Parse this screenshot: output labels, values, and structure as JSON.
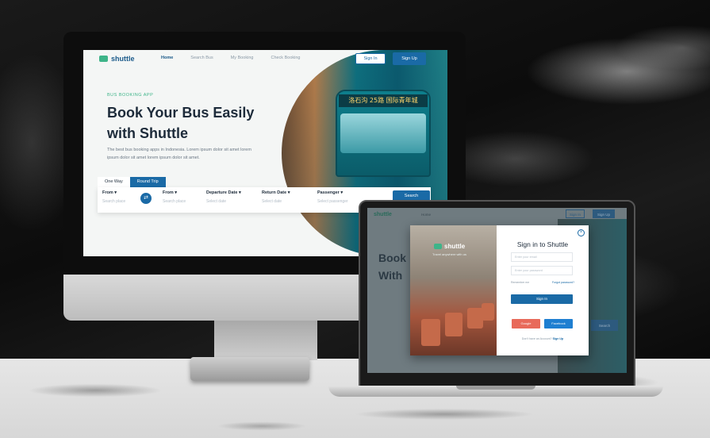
{
  "desktop": {
    "logo": "shuttle",
    "nav": [
      "Home",
      "Search Bus",
      "My Booking",
      "Check Booking"
    ],
    "sign_in": "Sign In",
    "sign_up": "Sign Up",
    "eyebrow": "BUS BOOKING APP",
    "title": "Book Your Bus Easily with Shuttle",
    "description": "The best bus booking apps in Indonesia. Lorem ipsum dolor sit amet lorem ipsum dolor sit amet lorem ipsum dolor sit amet.",
    "tabs": [
      "One Way",
      "Round Trip"
    ],
    "fields": [
      {
        "label": "From",
        "placeholder": "Search place"
      },
      {
        "label": "From",
        "placeholder": "Search place"
      },
      {
        "label": "Departure Date",
        "placeholder": "Select date"
      },
      {
        "label": "Return Date",
        "placeholder": "Select date"
      },
      {
        "label": "Passenger",
        "placeholder": "Select passenger"
      }
    ],
    "search": "Search",
    "bus_sign": "洛石沟 25路 国际青年城"
  },
  "laptop": {
    "logo": "shuttle",
    "nav_home": "Home",
    "title_line1": "Book",
    "title_line2": "With",
    "modal": {
      "brand": "shuttle",
      "tagline": "Travel anywhere with us",
      "title": "Sign in to Shuttle",
      "email_placeholder": "Enter your email",
      "password_placeholder": "Enter your password",
      "remember": "Remember me",
      "forgot": "Forgot password?",
      "sign_in": "Sign In",
      "google": "Google",
      "facebook": "Facebook",
      "footer_text": "Don't have an Account?",
      "footer_link": "Sign Up"
    },
    "bg_sign_in": "Sign In",
    "bg_sign_up": "Sign Up",
    "bg_search": "Search"
  }
}
